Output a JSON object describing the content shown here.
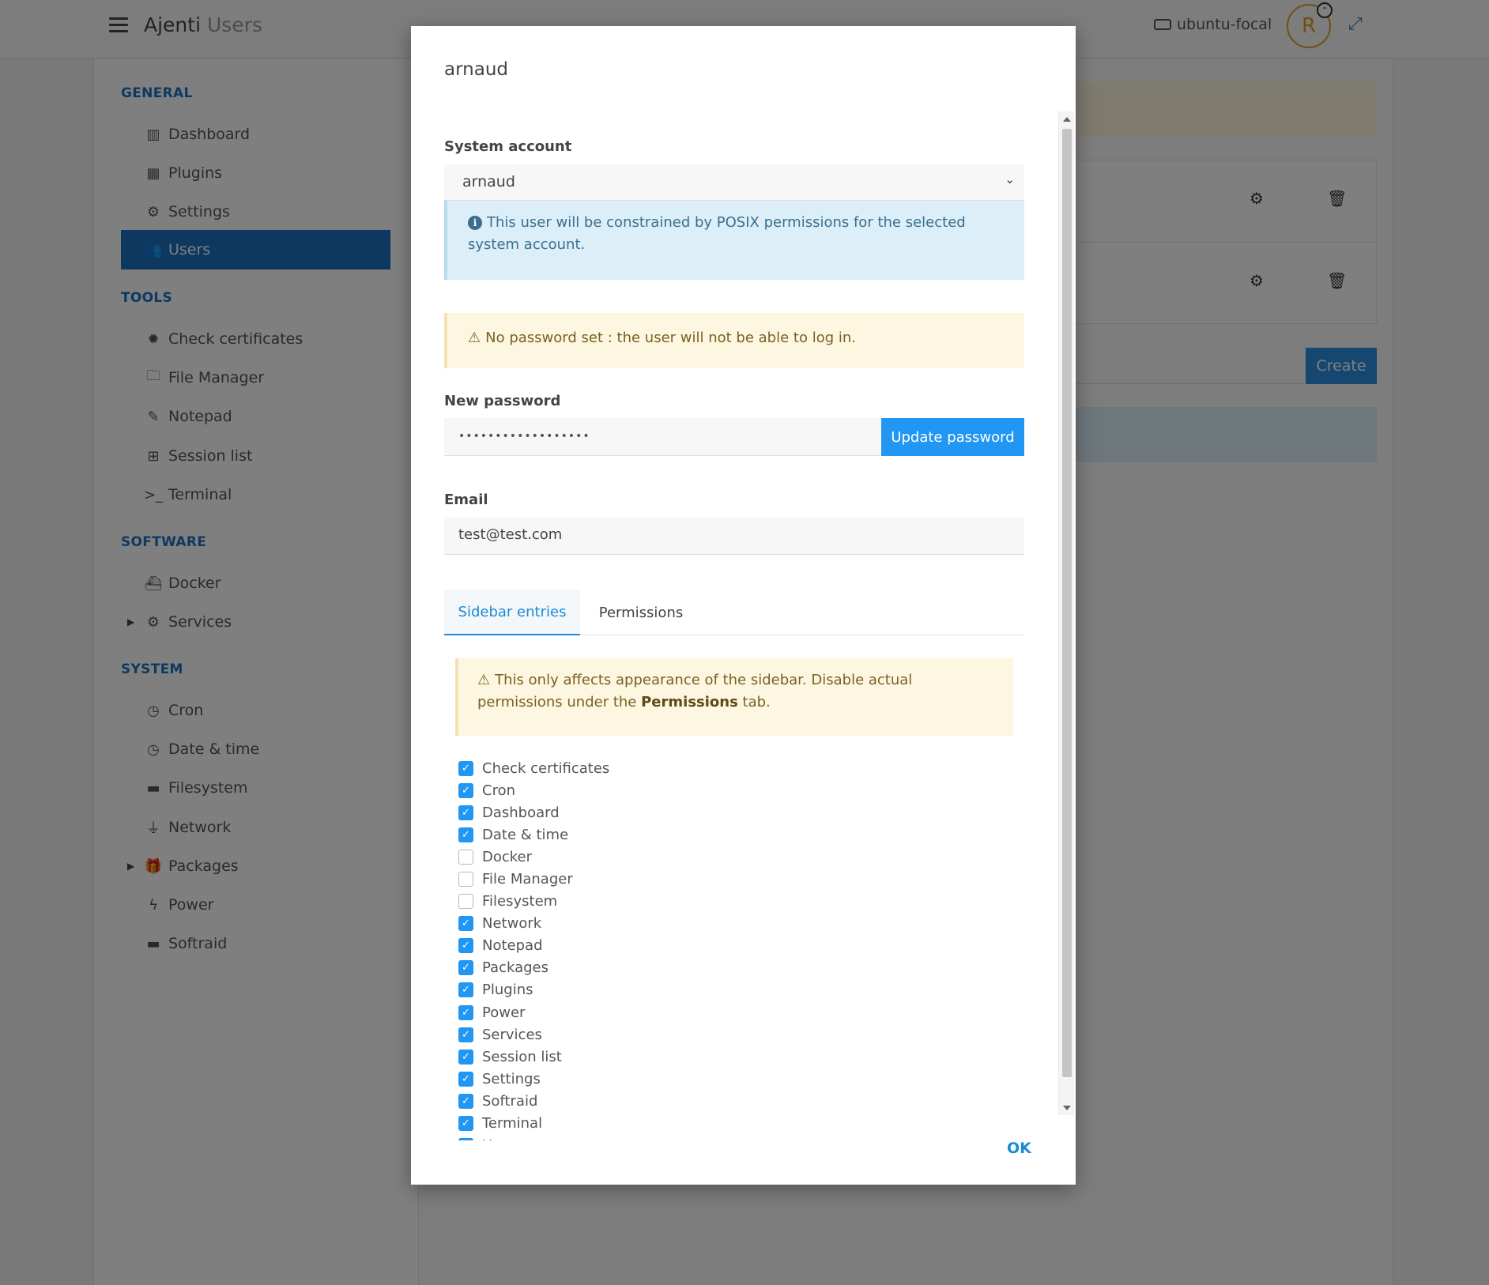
{
  "app": {
    "title": "Ajenti",
    "section": "Users",
    "host": "ubuntu-focal",
    "avatar_letter": "R",
    "accent": "#1a73c0"
  },
  "sidebar": {
    "sections": [
      {
        "title": "GENERAL",
        "items": [
          {
            "label": "Dashboard",
            "icon": "chart-icon"
          },
          {
            "label": "Plugins",
            "icon": "grid-icon"
          },
          {
            "label": "Settings",
            "icon": "gear-icon"
          },
          {
            "label": "Users",
            "icon": "users-icon",
            "active": true
          }
        ]
      },
      {
        "title": "TOOLS",
        "items": [
          {
            "label": "Check certificates",
            "icon": "certificate-icon"
          },
          {
            "label": "File Manager",
            "icon": "folder-icon"
          },
          {
            "label": "Notepad",
            "icon": "pencil-icon"
          },
          {
            "label": "Session list",
            "icon": "sitemap-icon"
          },
          {
            "label": "Terminal",
            "icon": "terminal-icon"
          }
        ]
      },
      {
        "title": "SOFTWARE",
        "items": [
          {
            "label": "Docker",
            "icon": "docker-icon"
          },
          {
            "label": "Services",
            "icon": "cogs-icon",
            "expandable": true
          }
        ]
      },
      {
        "title": "SYSTEM",
        "items": [
          {
            "label": "Cron",
            "icon": "clock-icon"
          },
          {
            "label": "Date & time",
            "icon": "clock-icon"
          },
          {
            "label": "Filesystem",
            "icon": "hdd-icon"
          },
          {
            "label": "Network",
            "icon": "plug-icon"
          },
          {
            "label": "Packages",
            "icon": "gift-icon",
            "expandable": true
          },
          {
            "label": "Power",
            "icon": "bolt-icon"
          },
          {
            "label": "Softraid",
            "icon": "hdd-icon"
          }
        ]
      }
    ]
  },
  "background": {
    "create_label": "Create"
  },
  "modal": {
    "title": "arnaud",
    "system_account_label": "System account",
    "system_account_value": "arnaud",
    "info_text": "This user will be constrained by POSIX permissions for the selected system account.",
    "no_password_warning": "No password set : the user will not be able to log in.",
    "new_password_label": "New password",
    "new_password_value": "••••••••••••••••••",
    "update_password_label": "Update password",
    "email_label": "Email",
    "email_value": "test@test.com",
    "tabs": [
      {
        "label": "Sidebar entries",
        "active": true
      },
      {
        "label": "Permissions",
        "active": false
      }
    ],
    "sidebar_warning_pre": "This only affects appearance of the sidebar. Disable actual permissions under the ",
    "sidebar_warning_bold": "Permissions",
    "sidebar_warning_post": " tab.",
    "entries": [
      {
        "label": "Check certificates",
        "checked": true
      },
      {
        "label": "Cron",
        "checked": true
      },
      {
        "label": "Dashboard",
        "checked": true
      },
      {
        "label": "Date & time",
        "checked": true
      },
      {
        "label": "Docker",
        "checked": false
      },
      {
        "label": "File Manager",
        "checked": false
      },
      {
        "label": "Filesystem",
        "checked": false
      },
      {
        "label": "Network",
        "checked": true
      },
      {
        "label": "Notepad",
        "checked": true
      },
      {
        "label": "Packages",
        "checked": true
      },
      {
        "label": "Plugins",
        "checked": true
      },
      {
        "label": "Power",
        "checked": true
      },
      {
        "label": "Services",
        "checked": true
      },
      {
        "label": "Session list",
        "checked": true
      },
      {
        "label": "Settings",
        "checked": true
      },
      {
        "label": "Softraid",
        "checked": true
      },
      {
        "label": "Terminal",
        "checked": true
      },
      {
        "label": "Users",
        "checked": true
      }
    ],
    "ok_label": "OK"
  }
}
